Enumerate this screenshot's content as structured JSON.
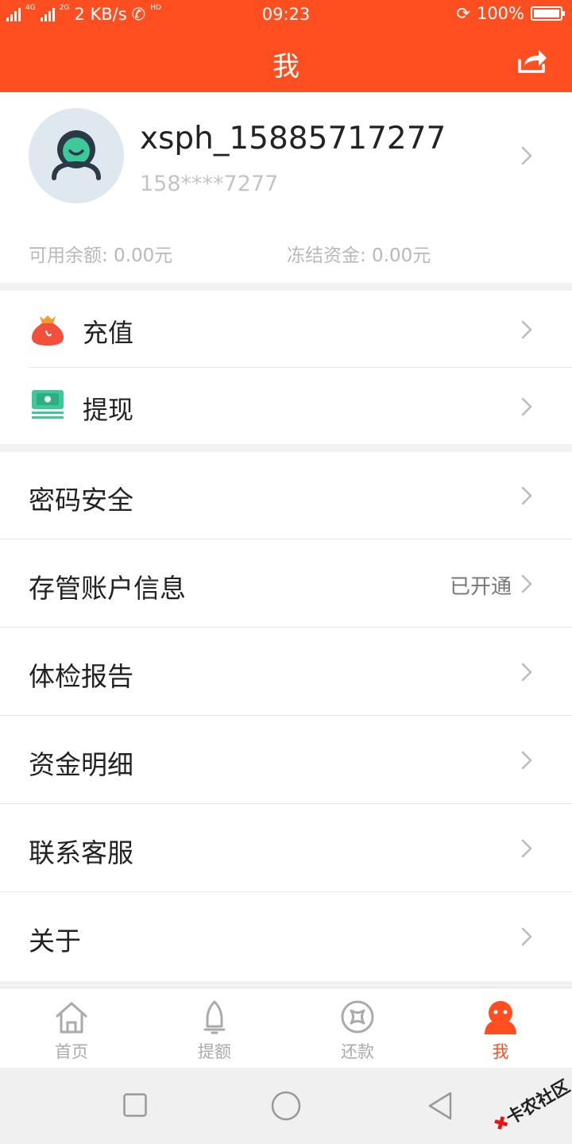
{
  "status_bar": {
    "network_1": "4G",
    "network_2": "2G",
    "speed": "2 KB/s",
    "call_badge": "HD",
    "time": "09:23",
    "battery": "100%",
    "battery_level": 1.0
  },
  "header": {
    "title": "我"
  },
  "profile": {
    "username": "xsph_15885717277",
    "phone": "158****7277",
    "balance": "可用余额: 0.00元",
    "frozen": "冻结资金: 0.00元"
  },
  "wallet_menu": [
    {
      "label": "充值",
      "icon": "money-bag-icon"
    },
    {
      "label": "提现",
      "icon": "cash-icon"
    }
  ],
  "settings_menu": [
    {
      "label": "密码安全",
      "value": ""
    },
    {
      "label": "存管账户信息",
      "value": "已开通"
    },
    {
      "label": "体检报告",
      "value": ""
    },
    {
      "label": "资金明细",
      "value": ""
    },
    {
      "label": "联系客服",
      "value": ""
    },
    {
      "label": "关于",
      "value": ""
    }
  ],
  "tabs": [
    {
      "label": "首页",
      "icon": "home-icon",
      "active": false
    },
    {
      "label": "提额",
      "icon": "bell-icon",
      "active": false
    },
    {
      "label": "还款",
      "icon": "repay-icon",
      "active": false
    },
    {
      "label": "我",
      "icon": "profile-icon",
      "active": true
    }
  ],
  "watermark": {
    "text": "卡农社区"
  },
  "colors": {
    "brand": "#ff4f21",
    "background": "#f2f2f2",
    "avatar_bg": "#dfe8ee",
    "cash_green": "#3ec99a"
  }
}
